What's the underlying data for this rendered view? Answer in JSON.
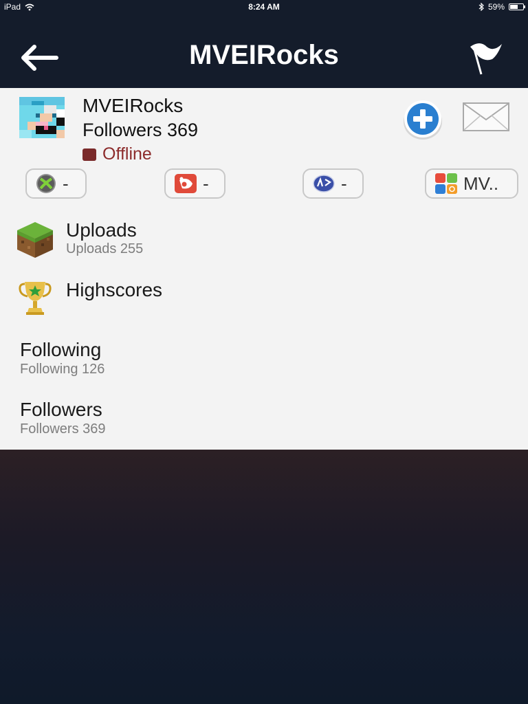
{
  "status_bar": {
    "device": "iPad",
    "time": "8:24 AM",
    "battery_percent": "59%",
    "battery_level": 0.59
  },
  "nav": {
    "title": "MVEIRocks",
    "back_icon": "back-arrow-icon",
    "flag_icon": "flag-icon"
  },
  "profile": {
    "name": "MVEIRocks",
    "followers": "Followers 369",
    "status": "Offline",
    "status_color": "#7a2a2a"
  },
  "actions": {
    "add_icon": "plus-circle-icon",
    "mail_icon": "envelope-icon"
  },
  "gamer_tags": [
    {
      "platform": "xbox",
      "value": "-"
    },
    {
      "platform": "game-center",
      "value": "-"
    },
    {
      "platform": "playstation",
      "value": "-"
    },
    {
      "platform": "apps",
      "value": "MV.."
    }
  ],
  "menu": {
    "uploads": {
      "title": "Uploads",
      "subtitle": "Uploads 255"
    },
    "highscores": {
      "title": "Highscores"
    },
    "following": {
      "title": "Following",
      "subtitle": "Following 126"
    },
    "followers": {
      "title": "Followers",
      "subtitle": "Followers 369"
    }
  },
  "colors": {
    "nav_background": "#141c2b",
    "content_background": "#f3f3f3",
    "accent_blue": "#2a7fd0"
  }
}
